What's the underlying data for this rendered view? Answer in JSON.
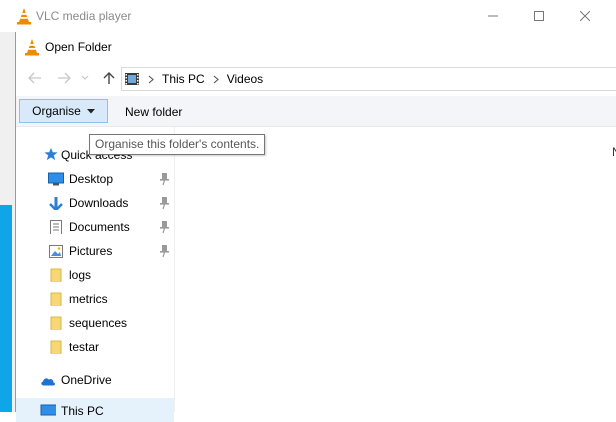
{
  "vlc_window": {
    "title": "VLC media player"
  },
  "dialog": {
    "title": "Open Folder",
    "breadcrumb": [
      "This PC",
      "Videos"
    ],
    "toolbar": {
      "organise_label": "Organise",
      "new_folder_label": "New folder"
    },
    "tooltip": "Organise this folder's contents.",
    "nav_items": [
      {
        "label": "Quick access",
        "icon": "star-icon",
        "pinned": false
      },
      {
        "label": "Desktop",
        "icon": "desktop-icon",
        "pinned": true
      },
      {
        "label": "Downloads",
        "icon": "download-icon",
        "pinned": true
      },
      {
        "label": "Documents",
        "icon": "document-icon",
        "pinned": true
      },
      {
        "label": "Pictures",
        "icon": "pictures-icon",
        "pinned": true
      },
      {
        "label": "logs",
        "icon": "folder-icon",
        "pinned": false
      },
      {
        "label": "metrics",
        "icon": "folder-icon",
        "pinned": false
      },
      {
        "label": "sequences",
        "icon": "folder-icon",
        "pinned": false
      },
      {
        "label": "testar",
        "icon": "folder-icon",
        "pinned": false
      },
      {
        "label": "OneDrive",
        "icon": "cloud-icon",
        "pinned": false
      },
      {
        "label": "This PC",
        "icon": "computer-icon",
        "pinned": false
      }
    ],
    "partial_column_text": "N"
  },
  "colors": {
    "accent": "#0078d7",
    "organise_bg": "#d8eaf9",
    "folder": "#f8d775"
  }
}
